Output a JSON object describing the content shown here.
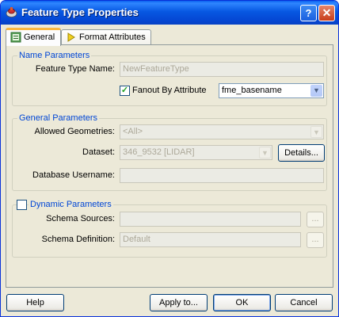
{
  "window": {
    "title": "Feature Type Properties",
    "help_glyph": "?",
    "close_glyph": "✕"
  },
  "tabs": [
    {
      "label": "General",
      "icon": "general-tab-icon",
      "active": true
    },
    {
      "label": "Format Attributes",
      "icon": "format-attributes-icon",
      "active": false
    }
  ],
  "name_parameters": {
    "legend": "Name Parameters",
    "feature_type_name_label": "Feature Type Name:",
    "feature_type_name_value": "NewFeatureType",
    "fanout_label": "Fanout By Attribute",
    "fanout_checked": true,
    "fanout_attribute": "fme_basename"
  },
  "general_parameters": {
    "legend": "General Parameters",
    "allowed_geometries_label": "Allowed Geometries:",
    "allowed_geometries_value": "<All>",
    "dataset_label": "Dataset:",
    "dataset_value": "346_9532 [LIDAR]",
    "details_button": "Details...",
    "database_username_label": "Database Username:",
    "database_username_value": ""
  },
  "dynamic_parameters": {
    "legend": "Dynamic Parameters",
    "checked": false,
    "schema_sources_label": "Schema Sources:",
    "schema_sources_value": "",
    "schema_definition_label": "Schema Definition:",
    "schema_definition_value": "Default",
    "browse_label": "..."
  },
  "buttons": {
    "help": "Help",
    "apply_to": "Apply to...",
    "ok": "OK",
    "cancel": "Cancel"
  },
  "colors": {
    "title_bar": "#0548d4",
    "legend_text": "#0046d5",
    "dialog_bg": "#ece9d8"
  }
}
